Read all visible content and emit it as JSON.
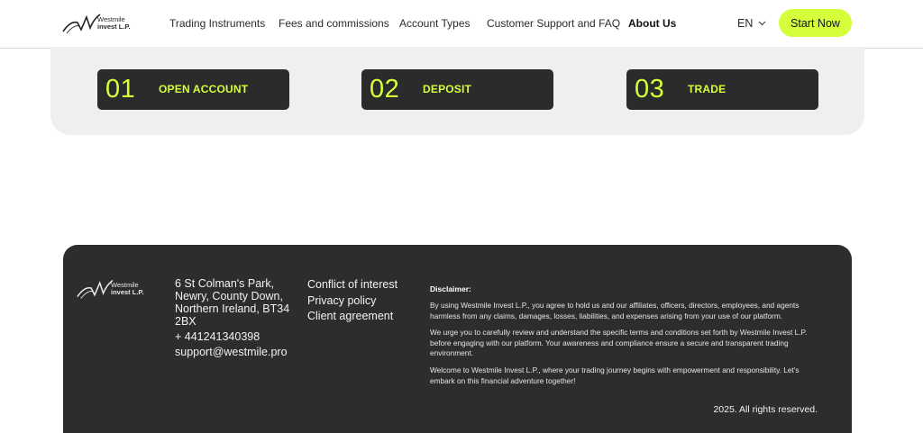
{
  "brand": {
    "line1": "Westmile",
    "line2": "invest L.P."
  },
  "nav": {
    "items": [
      {
        "label": "Trading Instruments"
      },
      {
        "label": "Fees and commissions"
      },
      {
        "label": "Account Types"
      },
      {
        "label": "Customer Support and FAQ"
      },
      {
        "label": "About Us"
      }
    ],
    "language": "EN",
    "cta_label": "Start Now"
  },
  "steps": [
    {
      "num": "01",
      "label": "OPEN ACCOUNT"
    },
    {
      "num": "02",
      "label": "DEPOSIT"
    },
    {
      "num": "03",
      "label": "TRADE"
    }
  ],
  "footer": {
    "brand": {
      "line1": "Westmile",
      "line2": "invest L.P."
    },
    "address": "6 St Colman's Park, Newry, County Down, Northern Ireland, BT34 2BX",
    "phone": "+ 441241340398",
    "email": "support@westmile.pro",
    "links": [
      "Conflict of interest",
      "Privacy policy",
      "Client agreement"
    ],
    "disclaimer_title": "Disclaimer:",
    "disclaimer_paragraphs": [
      "By using Westmile Invest L.P., you agree to hold us and our affiliates, officers, directors, employees, and agents harmless from any claims, damages, losses, liabilities, and expenses arising from your use of our platform.",
      "We urge you to carefully review and understand the specific terms and conditions set forth by Westmile Invest L.P. before engaging with our platform. Your awareness and compliance ensure a secure and transparent trading environment.",
      "Welcome to Westmile Invest L.P., where your trading journey begins with empowerment and responsibility. Let's embark on this financial adventure together!"
    ],
    "copyright": "2025. All rights reserved."
  },
  "colors": {
    "accent": "#d4ff3a",
    "dark": "#2d2d2d",
    "panel": "#efefef"
  },
  "icons": {
    "logo": "westmile-logo-icon",
    "chevron": "chevron-down-icon"
  }
}
